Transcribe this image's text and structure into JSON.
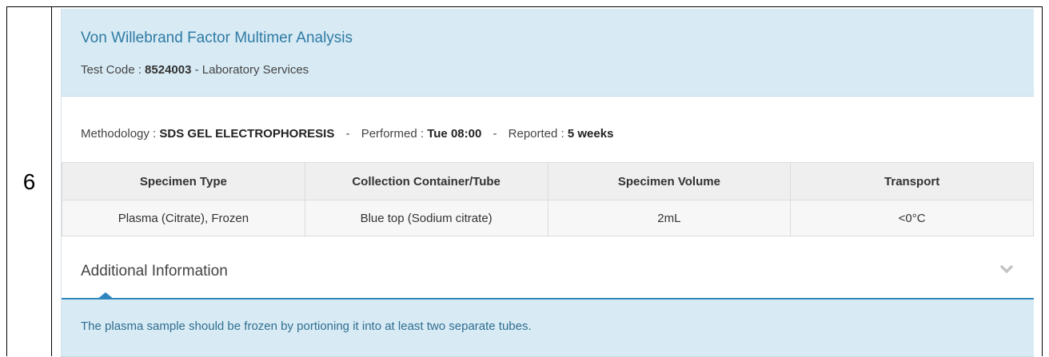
{
  "row_number": "6",
  "test": {
    "title": "Von Willebrand Factor Multimer Analysis",
    "code_label": "Test Code : ",
    "code": "8524003",
    "code_suffix": " - Laboratory Services"
  },
  "method": {
    "label": "Methodology : ",
    "value": "SDS GEL ELECTROPHORESIS",
    "separator": "-",
    "performed_label": "Performed : ",
    "performed_value": "Tue 08:00",
    "reported_label": "Reported : ",
    "reported_value": "5 weeks"
  },
  "specimen_table": {
    "headers": [
      "Specimen Type",
      "Collection Container/Tube",
      "Specimen Volume",
      "Transport"
    ],
    "row": [
      "Plasma (Citrate), Frozen",
      "Blue top (Sodium citrate)",
      "2mL",
      "<0°C"
    ]
  },
  "additional": {
    "title": "Additional Information",
    "chevron_icon": "chevron-down-icon",
    "text": "The plasma sample should be frozen by portioning it into at least two separate tubes."
  }
}
